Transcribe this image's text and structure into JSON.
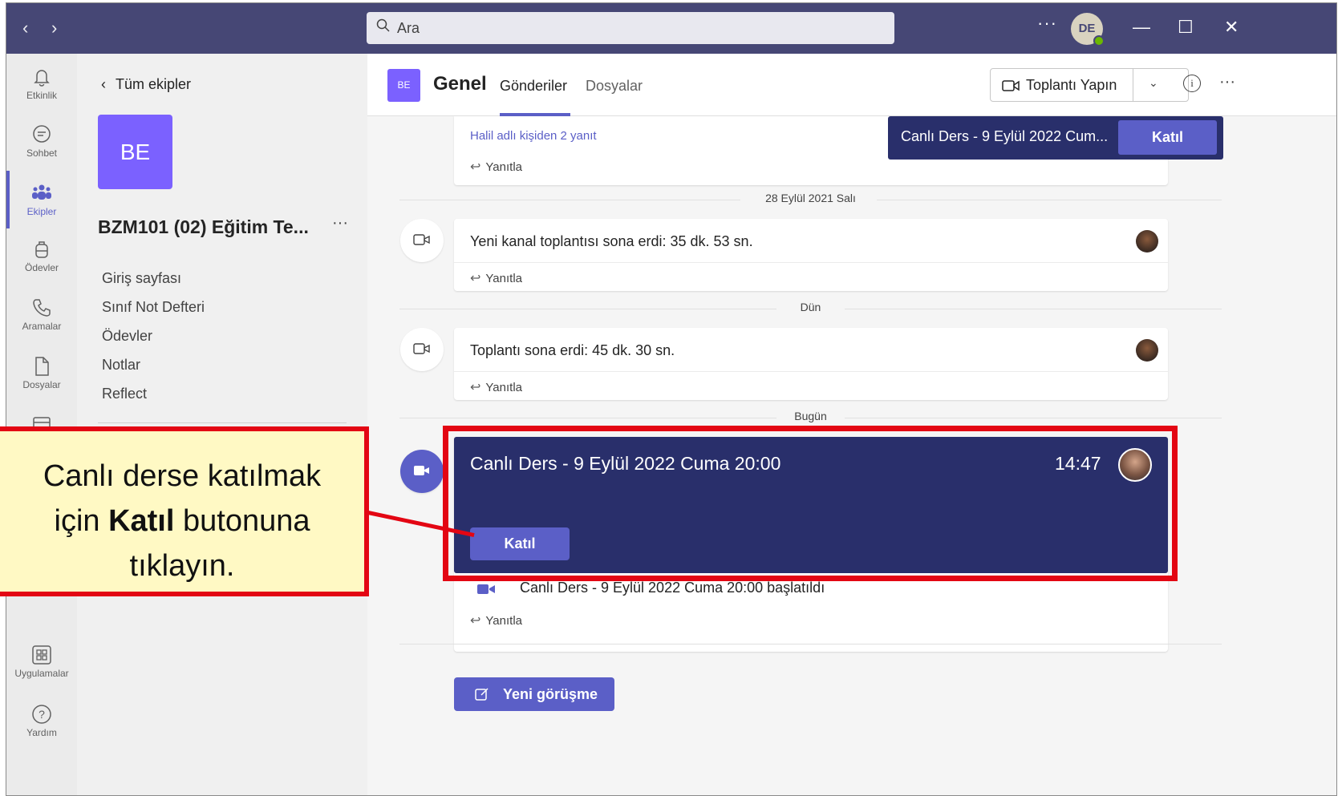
{
  "titlebar": {
    "back": "‹",
    "forward": "›",
    "search_placeholder": "Ara",
    "more": "···",
    "avatar_initials": "DE",
    "minimize": "—",
    "maximize": "☐",
    "close": "✕"
  },
  "rail": {
    "items": [
      {
        "label": "Etkinlik",
        "icon": "bell-icon"
      },
      {
        "label": "Sohbet",
        "icon": "chat-icon"
      },
      {
        "label": "Ekipler",
        "icon": "teams-icon"
      },
      {
        "label": "Ödevler",
        "icon": "backpack-icon"
      },
      {
        "label": "Aramalar",
        "icon": "phone-icon"
      },
      {
        "label": "Dosyalar",
        "icon": "file-icon"
      },
      {
        "label": "Uygulamalar",
        "icon": "apps-icon"
      },
      {
        "label": "Yardım",
        "icon": "help-icon"
      }
    ],
    "active_index": 2,
    "accent": "#5b5fc7"
  },
  "team": {
    "back_label": "Tüm ekipler",
    "tile": "BE",
    "name": "BZM101 (02) Eğitim Te...",
    "more": "···",
    "links": [
      "Giriş sayfası",
      "Sınıf Not Defteri",
      "Ödevler",
      "Notlar",
      "Reflect"
    ]
  },
  "channel": {
    "tile": "BE",
    "name": "Genel",
    "tabs": [
      "Gönderiler",
      "Dosyalar"
    ],
    "active_tab": "Gönderiler",
    "meet_button": "Toplantı Yapın",
    "more": "···"
  },
  "feed": {
    "top_card": {
      "reply_link": "Halil adlı kişiden 2 yanıt",
      "reply": "Yanıtla"
    },
    "floating": {
      "title": "Canlı Ders - 9 Eylül 2022 Cum...",
      "join": "Katıl"
    },
    "sep1": "28 Eylül 2021 Salı",
    "card1": {
      "message": "Yeni kanal toplantısı sona erdi: 35 dk. 53 sn.",
      "reply": "Yanıtla"
    },
    "sep2": "Dün",
    "card2": {
      "message": "Toplantı sona erdi: 45 dk. 30 sn.",
      "reply": "Yanıtla"
    },
    "sep3": "Bugün",
    "live": {
      "title": "Canlı Ders - 9 Eylül 2022 Cuma 20:00",
      "time": "14:47",
      "join": "Katıl",
      "started": "Canlı Ders - 9 Eylül 2022 Cuma 20:00 başlatıldı",
      "reply": "Yanıtla"
    },
    "new_conversation": "Yeni görüşme"
  },
  "annotation": {
    "line1": "Canlı derse katılmak",
    "line2_pre": "için ",
    "line2_bold": "Katıl",
    "line2_post": " butonuna",
    "line3": "tıklayın.",
    "color": "#e30613",
    "fill": "#fff9c4"
  }
}
